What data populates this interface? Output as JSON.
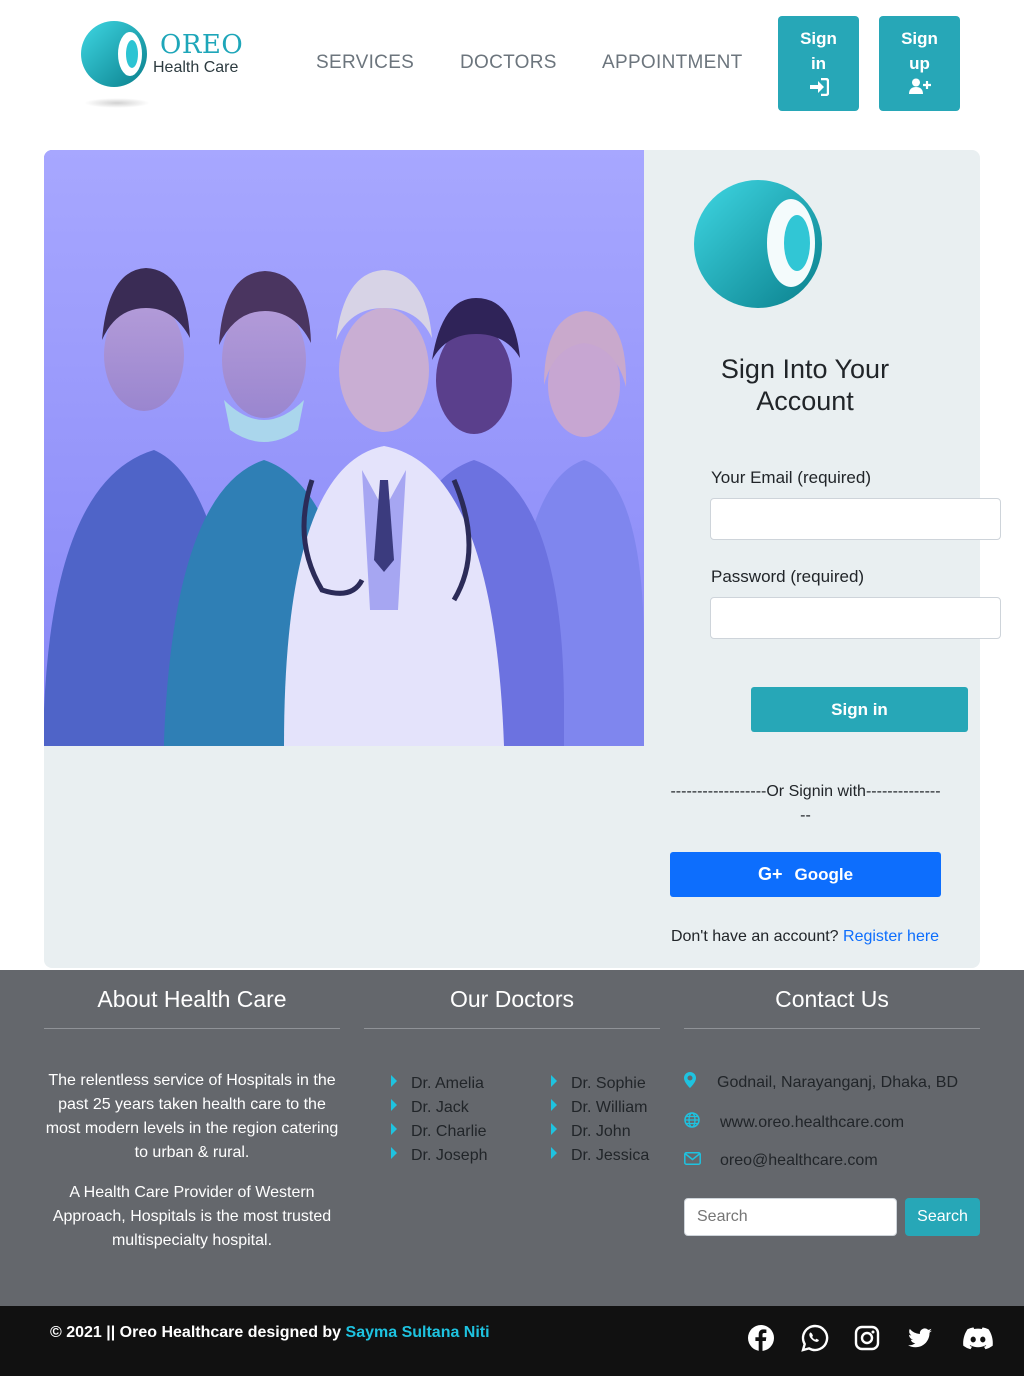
{
  "brand": {
    "name": "OREO",
    "subtitle": "Health Care",
    "colors": {
      "primary": "#27a7b7",
      "accent": "#1ec3e0",
      "google": "#0d6efd",
      "footer": "#64676c",
      "bottom_bar": "#111111"
    }
  },
  "nav": {
    "links": [
      "SERVICES",
      "DOCTORS",
      "APPOINTMENT"
    ],
    "signin": {
      "line1": "Sign",
      "line2": "in",
      "icon": "sign-in-icon"
    },
    "signup": {
      "line1": "Sign",
      "line2": "up",
      "icon": "user-plus-icon"
    }
  },
  "login": {
    "title_line1": "Sign Into Your",
    "title_line2": "Account",
    "email_label": "Your Email (required)",
    "email_value": "",
    "password_label": "Password (required)",
    "password_value": "",
    "submit_label": "Sign in",
    "or_text": "------------------Or Signin with----------------",
    "google_icon": "G+",
    "google_label": "Google",
    "register_prompt": "Don't have an account?",
    "register_link": "Register here"
  },
  "footer": {
    "about": {
      "heading": "About Health Care",
      "para1": "The relentless service of Hospitals in the past 25 years taken health care to the most modern levels in the region catering to urban & rural.",
      "para2": "A Health Care Provider of Western Approach, Hospitals is the most trusted multispecialty hospital."
    },
    "doctors": {
      "heading": "Our Doctors",
      "col1": [
        "Dr. Amelia",
        "Dr. Jack",
        "Dr. Charlie",
        "Dr. Joseph"
      ],
      "col2": [
        "Dr. Sophie",
        "Dr. William",
        "Dr. John",
        "Dr. Jessica"
      ]
    },
    "contact": {
      "heading": "Contact Us",
      "address": "Godnail, Narayanganj, Dhaka, BD",
      "website": "www.oreo.healthcare.com",
      "email": "oreo@healthcare.com",
      "search_placeholder": "Search",
      "search_button": "Search"
    },
    "copyright_prefix": "© 2021 || Oreo Healthcare designed by",
    "copyright_author": "Sayma Sultana Niti",
    "social_icons": [
      "facebook-icon",
      "whatsapp-icon",
      "instagram-icon",
      "twitter-icon",
      "discord-icon"
    ]
  }
}
